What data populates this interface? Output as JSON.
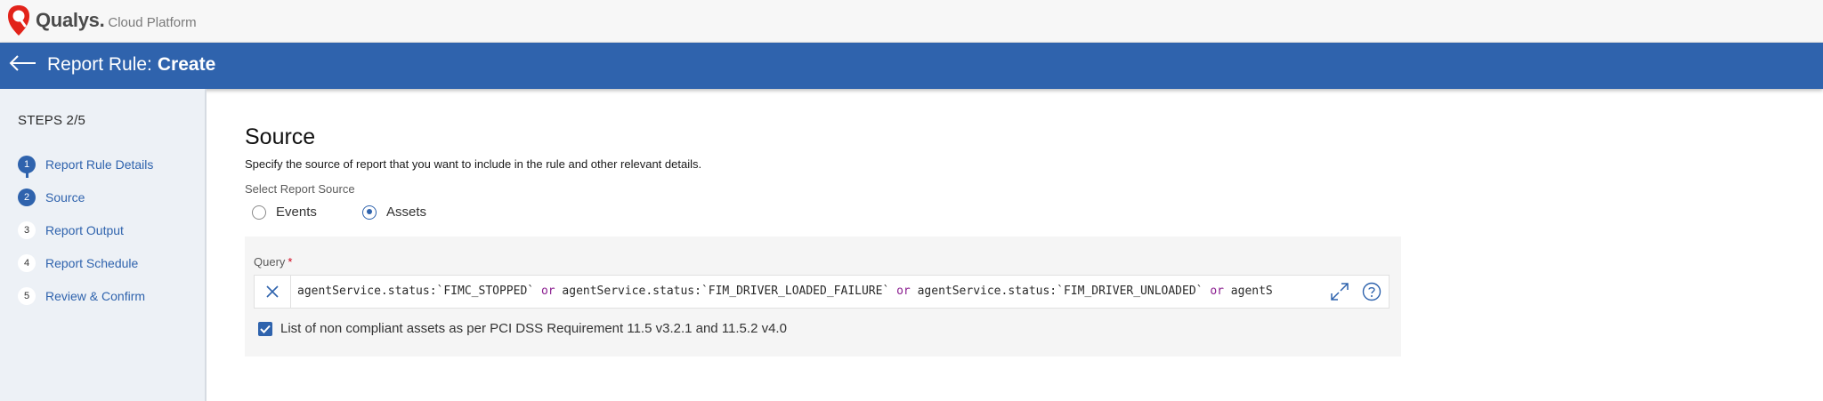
{
  "brand": {
    "name": "Qualys",
    "dot": ".",
    "subtitle": "Cloud Platform",
    "color": "#e2231a"
  },
  "header": {
    "title_prefix": "Report Rule:",
    "title_action": "Create",
    "background": "#2f63ad"
  },
  "sidebar": {
    "steps_label": "STEPS 2/5",
    "steps": [
      {
        "number": "1",
        "label": "Report Rule Details",
        "state": "completed"
      },
      {
        "number": "2",
        "label": "Source",
        "state": "current"
      },
      {
        "number": "3",
        "label": "Report Output",
        "state": "pending"
      },
      {
        "number": "4",
        "label": "Report Schedule",
        "state": "pending"
      },
      {
        "number": "5",
        "label": "Review & Confirm",
        "state": "pending"
      }
    ]
  },
  "main": {
    "title": "Source",
    "description": "Specify the source of report that you want to include in the rule and other relevant details.",
    "source_label": "Select Report Source",
    "radio_options": [
      {
        "label": "Events",
        "checked": false
      },
      {
        "label": "Assets",
        "checked": true
      }
    ],
    "query": {
      "label": "Query",
      "required_mark": "*",
      "segments": [
        {
          "text": "agentService.status:`FIMC_STOPPED` ",
          "keyword": false
        },
        {
          "text": "or",
          "keyword": true
        },
        {
          "text": " agentService.status:`FIM_DRIVER_LOADED_FAILURE` ",
          "keyword": false
        },
        {
          "text": "or",
          "keyword": true
        },
        {
          "text": " agentService.status:`FIM_DRIVER_UNLOADED` ",
          "keyword": false
        },
        {
          "text": "or",
          "keyword": true
        },
        {
          "text": " agentS",
          "keyword": false
        }
      ]
    },
    "checkbox": {
      "label": "List of non compliant assets as per PCI DSS Requirement 11.5 v3.2.1 and 11.5.2 v4.0",
      "checked": true
    }
  },
  "icons": {
    "back": "arrow-left-icon",
    "clear": "close-icon",
    "expand": "expand-icon",
    "help": "help-circle-icon",
    "logo": "qualys-shield-icon"
  }
}
